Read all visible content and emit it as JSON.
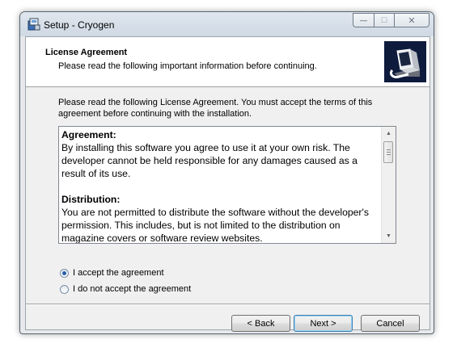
{
  "window": {
    "title": "Setup - Cryogen",
    "controls": {
      "minimize": "—",
      "maximize": "☐",
      "close": "✕"
    }
  },
  "header": {
    "title": "License Agreement",
    "subtitle": "Please read the following important information before continuing."
  },
  "intro": "Please read the following License Agreement. You must accept the terms of this agreement before continuing with the installation.",
  "license": {
    "sections": [
      {
        "heading": "Agreement:",
        "body": "By installing this software you agree to use it at your own risk. The developer cannot be held responsible for any damages caused as a result of its use."
      },
      {
        "heading": "Distribution:",
        "body": "You are not permitted to distribute the software without the developer's permission. This includes, but is not limited to the distribution on magazine covers or software review websites."
      }
    ]
  },
  "options": {
    "accept": "I accept the agreement",
    "decline": "I do not accept the agreement",
    "selected": "accept"
  },
  "buttons": {
    "back": "< Back",
    "next": "Next >",
    "cancel": "Cancel"
  }
}
